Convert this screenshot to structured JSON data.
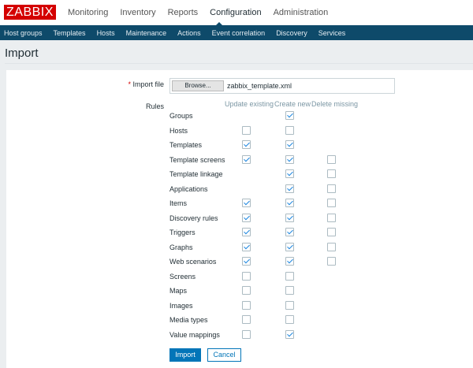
{
  "header": {
    "logo": "ZABBIX",
    "menu": [
      "Monitoring",
      "Inventory",
      "Reports",
      "Configuration",
      "Administration"
    ],
    "active": "Configuration"
  },
  "subnav": [
    "Host groups",
    "Templates",
    "Hosts",
    "Maintenance",
    "Actions",
    "Event correlation",
    "Discovery",
    "Services"
  ],
  "page_title": "Import",
  "form": {
    "import_file_label": "Import file",
    "required_mark": "*",
    "browse_label": "Browse...",
    "file_name": "zabbix_template.xml",
    "rules_label": "Rules",
    "columns": [
      "Update existing",
      "Create new",
      "Delete missing"
    ],
    "rules": [
      {
        "name": "Groups",
        "update": null,
        "create": true,
        "delete": null
      },
      {
        "name": "Hosts",
        "update": false,
        "create": false,
        "delete": null
      },
      {
        "name": "Templates",
        "update": true,
        "create": true,
        "delete": null
      },
      {
        "name": "Template screens",
        "update": true,
        "create": true,
        "delete": false
      },
      {
        "name": "Template linkage",
        "update": null,
        "create": true,
        "delete": false
      },
      {
        "name": "Applications",
        "update": null,
        "create": true,
        "delete": false
      },
      {
        "name": "Items",
        "update": true,
        "create": true,
        "delete": false
      },
      {
        "name": "Discovery rules",
        "update": true,
        "create": true,
        "delete": false
      },
      {
        "name": "Triggers",
        "update": true,
        "create": true,
        "delete": false
      },
      {
        "name": "Graphs",
        "update": true,
        "create": true,
        "delete": false
      },
      {
        "name": "Web scenarios",
        "update": true,
        "create": true,
        "delete": false
      },
      {
        "name": "Screens",
        "update": false,
        "create": false,
        "delete": null
      },
      {
        "name": "Maps",
        "update": false,
        "create": false,
        "delete": null
      },
      {
        "name": "Images",
        "update": false,
        "create": false,
        "delete": null
      },
      {
        "name": "Media types",
        "update": false,
        "create": false,
        "delete": null
      },
      {
        "name": "Value mappings",
        "update": false,
        "create": true,
        "delete": null
      }
    ],
    "import_button": "Import",
    "cancel_button": "Cancel"
  }
}
